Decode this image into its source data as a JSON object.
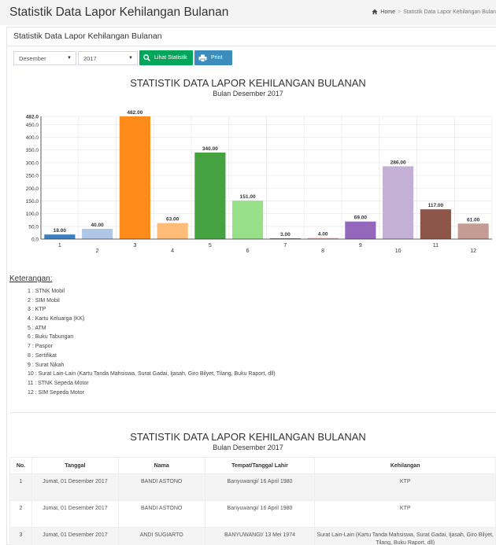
{
  "header": {
    "title": "Statistik Data Lapor Kehilangan Bulanan",
    "breadcrumb": [
      "Home",
      "Statistik Data Lapor Kehilangan Bulan"
    ]
  },
  "panel": {
    "title": "Statistik Data Lapor Kehilangan Bulanan",
    "month_select": "Desember",
    "year_select": "2017",
    "view_button": "Lihat Statistik",
    "print_button": "Print"
  },
  "chart_data": {
    "type": "bar",
    "title": "STATISTIK DATA LAPOR KEHILANGAN BULANAN",
    "subtitle": "Bulan Desember 2017",
    "categories": [
      "1",
      "2",
      "3",
      "4",
      "5",
      "6",
      "7",
      "8",
      "9",
      "10",
      "11",
      "12"
    ],
    "values": [
      18,
      40,
      482,
      63,
      340,
      151,
      3,
      4,
      69,
      286,
      117,
      61
    ],
    "value_labels": [
      "18.00",
      "40.00",
      "482.00",
      "63.00",
      "340.00",
      "151.00",
      "3.00",
      "4.00",
      "69.00",
      "286.00",
      "117.00",
      "61.00"
    ],
    "colors": [
      "#3e7fc1",
      "#aec7e8",
      "#ff8c1a",
      "#ffbb78",
      "#44a340",
      "#98df8a",
      "#e8413e",
      "#ff9896",
      "#9467bd",
      "#c5b0d5",
      "#8c564b",
      "#c49c94"
    ],
    "y_ticks": [
      "0.0",
      "50.0",
      "100.0",
      "150.0",
      "200.0",
      "250.0",
      "300.0",
      "350.0",
      "400.0",
      "450.0",
      "482.0"
    ],
    "ylim": [
      0,
      482
    ],
    "grid": true
  },
  "keterangan": {
    "title": "Keterangan:",
    "items": [
      "1 : STNK Mobil",
      "2 : SIM Mobil",
      "3 : KTP",
      "4 : Kartu Keluarga (KK)",
      "5 : ATM",
      "6 : Buku Tabungan",
      "7 : Paspor",
      "8 : Sertifikat",
      "9 : Surat Nikah",
      "10 : Surat Lain-Lain (Kartu Tanda Mahsiswa, Surat Gadai, Ijasah, Giro Bilyet, Tilang, Buku Raport, dll)",
      "11 : STNK Sepeda Motor",
      "12 : SIM Sepeda Motor"
    ]
  },
  "table_section": {
    "title": "STATISTIK DATA LAPOR KEHILANGAN BULANAN",
    "subtitle": "Bulan Desember 2017",
    "columns": [
      "No.",
      "Tanggal",
      "Nama",
      "Tempat/Tanggal Lahir",
      "Kehilangan"
    ],
    "rows": [
      [
        "1",
        "Jumat, 01 Desember 2017",
        "BANDI ASTONO",
        "Banyuwangi/ 16 April 1980",
        "KTP"
      ],
      [
        "2",
        "Jumat, 01 Desember 2017",
        "BANDI ASTONO",
        "Banyuwangi/ 16 April 1980",
        "KTP"
      ],
      [
        "3",
        "Jumat, 01 Desember 2017",
        "ANDI SUGIARTO",
        "BANYUWANGI/ 13 Mei 1974",
        "Surat Lain-Lain (Kartu Tanda Mahsiswa, Surat Gadai, Ijasah, Giro Bilyet, Tilang, Buku Raport, dll)"
      ]
    ]
  }
}
